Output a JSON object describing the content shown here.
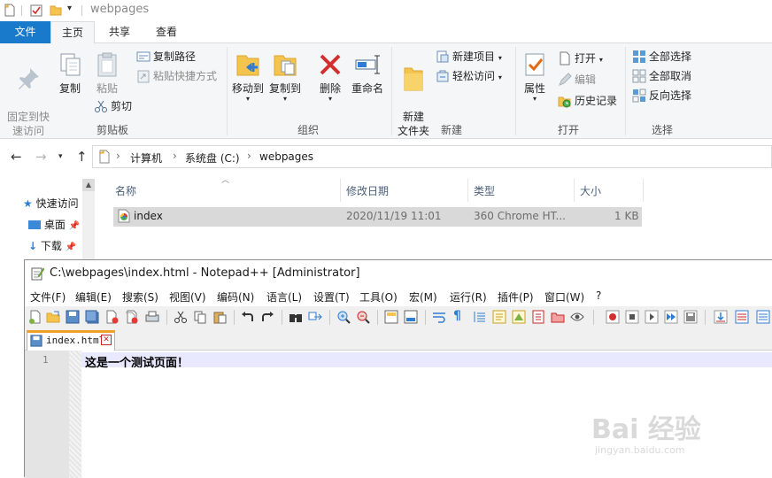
{
  "explorer": {
    "title": "webpages",
    "tabs": [
      "文件",
      "主页",
      "共享",
      "查看"
    ],
    "clipboard": {
      "pin_label": "固定到快\n速访问",
      "copy_label": "复制",
      "paste_label": "粘贴",
      "copy_path_label": "复制路径",
      "paste_shortcut_label": "粘贴快捷方式",
      "cut_label": "剪切",
      "group_label": "剪贴板"
    },
    "organize": {
      "move_to_label": "移动到",
      "copy_to_label": "复制到",
      "delete_label": "删除",
      "rename_label": "重命名",
      "group_label": "组织"
    },
    "new": {
      "new_folder_label": "新建\n文件夹",
      "new_item_label": "新建项目",
      "easy_access_label": "轻松访问",
      "group_label": "新建"
    },
    "open": {
      "properties_label": "属性",
      "open_label": "打开",
      "edit_label": "编辑",
      "history_label": "历史记录",
      "group_label": "打开"
    },
    "select": {
      "select_all_label": "全部选择",
      "select_none_label": "全部取消",
      "invert_label": "反向选择",
      "group_label": "选择"
    },
    "address": {
      "crumbs": [
        "计算机",
        "系统盘 (C:)",
        "webpages"
      ]
    },
    "nav_pane": {
      "quick_access": "快速访问",
      "desktop": "桌面",
      "downloads": "下载"
    },
    "columns": [
      "名称",
      "修改日期",
      "类型",
      "大小"
    ],
    "files": [
      {
        "name": "index",
        "modified": "2020/11/19 11:01",
        "type": "360 Chrome HT...",
        "size": "1 KB"
      }
    ]
  },
  "notepad": {
    "title": "C:\\webpages\\index.html - Notepad++ [Administrator]",
    "menus": [
      "文件(F)",
      "编辑(E)",
      "搜索(S)",
      "视图(V)",
      "编码(N)",
      "语言(L)",
      "设置(T)",
      "工具(O)",
      "宏(M)",
      "运行(R)",
      "插件(P)",
      "窗口(W)",
      "?"
    ],
    "tab_label": "index.html",
    "line_number": "1",
    "line_text": "这是一个测试页面！"
  },
  "watermark": {
    "brand": "Bai 经验",
    "url": "jingyan.baidu.com"
  },
  "colors": {
    "file_tab_bg": "#1979ca",
    "ribbon_bg": "#f5f6f7",
    "selected_row": "#d9d9d9",
    "npp_tab_accent": "#f0a028",
    "npp_current_line": "#e8e8ff",
    "delete_red": "#d32f2f"
  }
}
